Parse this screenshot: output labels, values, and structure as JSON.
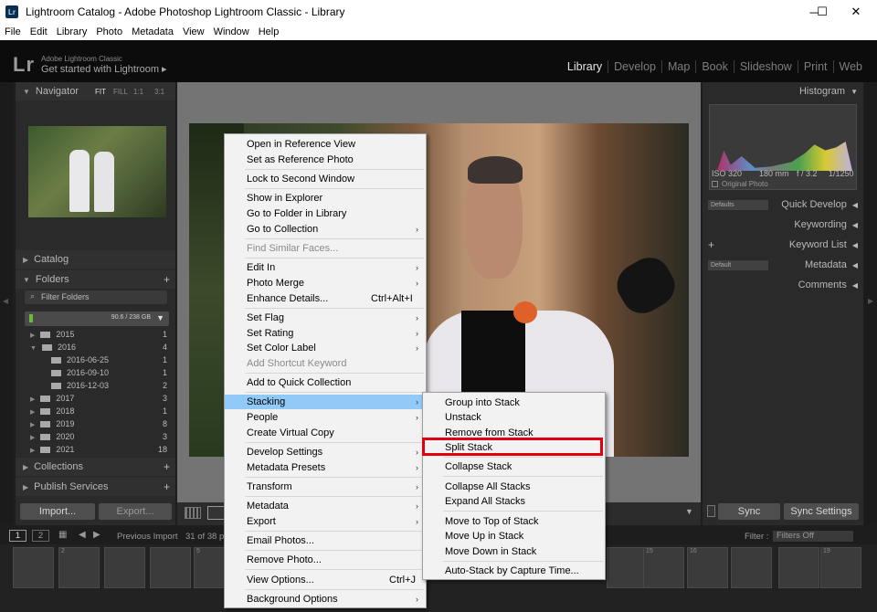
{
  "window": {
    "title": "Lightroom Catalog - Adobe Photoshop Lightroom Classic - Library",
    "app_icon": "Lr",
    "controls": {
      "minimize": "─",
      "maximize": "☐",
      "close": "✕"
    }
  },
  "menubar": [
    "File",
    "Edit",
    "Library",
    "Photo",
    "Metadata",
    "View",
    "Window",
    "Help"
  ],
  "identity": {
    "logo": "Lr",
    "line1": "Adobe Lightroom Classic",
    "line2": "Get started with Lightroom ▸"
  },
  "modules": [
    "Library",
    "Develop",
    "Map",
    "Book",
    "Slideshow",
    "Print",
    "Web"
  ],
  "active_module": "Library",
  "left_panel": {
    "navigator": {
      "title": "Navigator",
      "zoom_options": [
        "FIT",
        "FILL",
        "1:1",
        "3:1"
      ]
    },
    "catalog": "Catalog",
    "folders": {
      "title": "Folders",
      "filter_placeholder": "Filter Folders",
      "volume": "90.6 / 238 GB"
    },
    "folder_tree": [
      {
        "name": "2015",
        "count": "1"
      },
      {
        "name": "2016",
        "count": "4"
      },
      {
        "name": "2016-06-25",
        "count": "1"
      },
      {
        "name": "2016-09-10",
        "count": "1"
      },
      {
        "name": "2016-12-03",
        "count": "2"
      },
      {
        "name": "2017",
        "count": "3"
      },
      {
        "name": "2018",
        "count": "1"
      },
      {
        "name": "2019",
        "count": "8"
      },
      {
        "name": "2020",
        "count": "3"
      },
      {
        "name": "2021",
        "count": "18"
      }
    ],
    "collections": "Collections",
    "publish_services": "Publish Services",
    "import_btn": "Import...",
    "export_btn": "Export..."
  },
  "right_panel": {
    "histogram": "Histogram",
    "info": {
      "iso": "ISO 320",
      "focal": "180 mm",
      "aperture": "f / 3.2",
      "shutter": "1/1250"
    },
    "original_photo": "Original Photo",
    "defaults": "Defaults",
    "quick_develop": "Quick Develop",
    "keywording": "Keywording",
    "keyword_list": "Keyword List",
    "default_preset": "Default",
    "metadata": "Metadata",
    "comments": "Comments",
    "sync_btn": "Sync",
    "sync_settings_btn": "Sync Settings"
  },
  "filmstrip": {
    "page1": "1",
    "page2": "2",
    "source": "Previous Import",
    "count": "31 of 38 p",
    "filter_label": "Filter :",
    "filter_value": "Filters Off",
    "thumb_numbers": [
      "",
      "2",
      "",
      "",
      "5",
      "",
      "",
      "",
      "",
      "",
      "",
      "",
      "",
      "",
      "15",
      "16",
      "",
      "",
      "19"
    ]
  },
  "context_menu": {
    "items": [
      {
        "label": "Open in Reference View",
        "sub": false,
        "disabled": false,
        "shortcut": ""
      },
      {
        "label": "Set as Reference Photo",
        "sub": false,
        "disabled": false,
        "shortcut": ""
      },
      {
        "label": "Lock to Second Window",
        "sub": false,
        "disabled": false,
        "shortcut": ""
      },
      {
        "label": "Show in Explorer",
        "sub": false,
        "disabled": false,
        "shortcut": ""
      },
      {
        "label": "Go to Folder in Library",
        "sub": false,
        "disabled": false,
        "shortcut": ""
      },
      {
        "label": "Go to Collection",
        "sub": true,
        "disabled": false,
        "shortcut": ""
      },
      {
        "label": "Find Similar Faces...",
        "sub": false,
        "disabled": true,
        "shortcut": ""
      },
      {
        "label": "Edit In",
        "sub": true,
        "disabled": false,
        "shortcut": ""
      },
      {
        "label": "Photo Merge",
        "sub": true,
        "disabled": false,
        "shortcut": ""
      },
      {
        "label": "Enhance Details...",
        "sub": false,
        "disabled": false,
        "shortcut": "Ctrl+Alt+I"
      },
      {
        "label": "Set Flag",
        "sub": true,
        "disabled": false,
        "shortcut": ""
      },
      {
        "label": "Set Rating",
        "sub": true,
        "disabled": false,
        "shortcut": ""
      },
      {
        "label": "Set Color Label",
        "sub": true,
        "disabled": false,
        "shortcut": ""
      },
      {
        "label": "Add Shortcut Keyword",
        "sub": false,
        "disabled": true,
        "shortcut": ""
      },
      {
        "label": "Add to Quick Collection",
        "sub": false,
        "disabled": false,
        "shortcut": ""
      },
      {
        "label": "Stacking",
        "sub": true,
        "disabled": false,
        "shortcut": "",
        "highlighted": true
      },
      {
        "label": "People",
        "sub": true,
        "disabled": false,
        "shortcut": ""
      },
      {
        "label": "Create Virtual Copy",
        "sub": false,
        "disabled": false,
        "shortcut": ""
      },
      {
        "label": "Develop Settings",
        "sub": true,
        "disabled": false,
        "shortcut": ""
      },
      {
        "label": "Metadata Presets",
        "sub": true,
        "disabled": false,
        "shortcut": ""
      },
      {
        "label": "Transform",
        "sub": true,
        "disabled": false,
        "shortcut": ""
      },
      {
        "label": "Metadata",
        "sub": true,
        "disabled": false,
        "shortcut": ""
      },
      {
        "label": "Export",
        "sub": true,
        "disabled": false,
        "shortcut": ""
      },
      {
        "label": "Email Photos...",
        "sub": false,
        "disabled": false,
        "shortcut": ""
      },
      {
        "label": "Remove Photo...",
        "sub": false,
        "disabled": false,
        "shortcut": ""
      },
      {
        "label": "View Options...",
        "sub": false,
        "disabled": false,
        "shortcut": "Ctrl+J"
      },
      {
        "label": "Background Options",
        "sub": true,
        "disabled": false,
        "shortcut": ""
      }
    ]
  },
  "stacking_submenu": {
    "items": [
      "Group into Stack",
      "Unstack",
      "Remove from Stack",
      "Split Stack",
      "Collapse Stack",
      "Collapse All Stacks",
      "Expand All Stacks",
      "Move to Top of Stack",
      "Move Up in Stack",
      "Move Down in Stack",
      "Auto-Stack by Capture Time..."
    ],
    "highlighted": "Split Stack"
  }
}
